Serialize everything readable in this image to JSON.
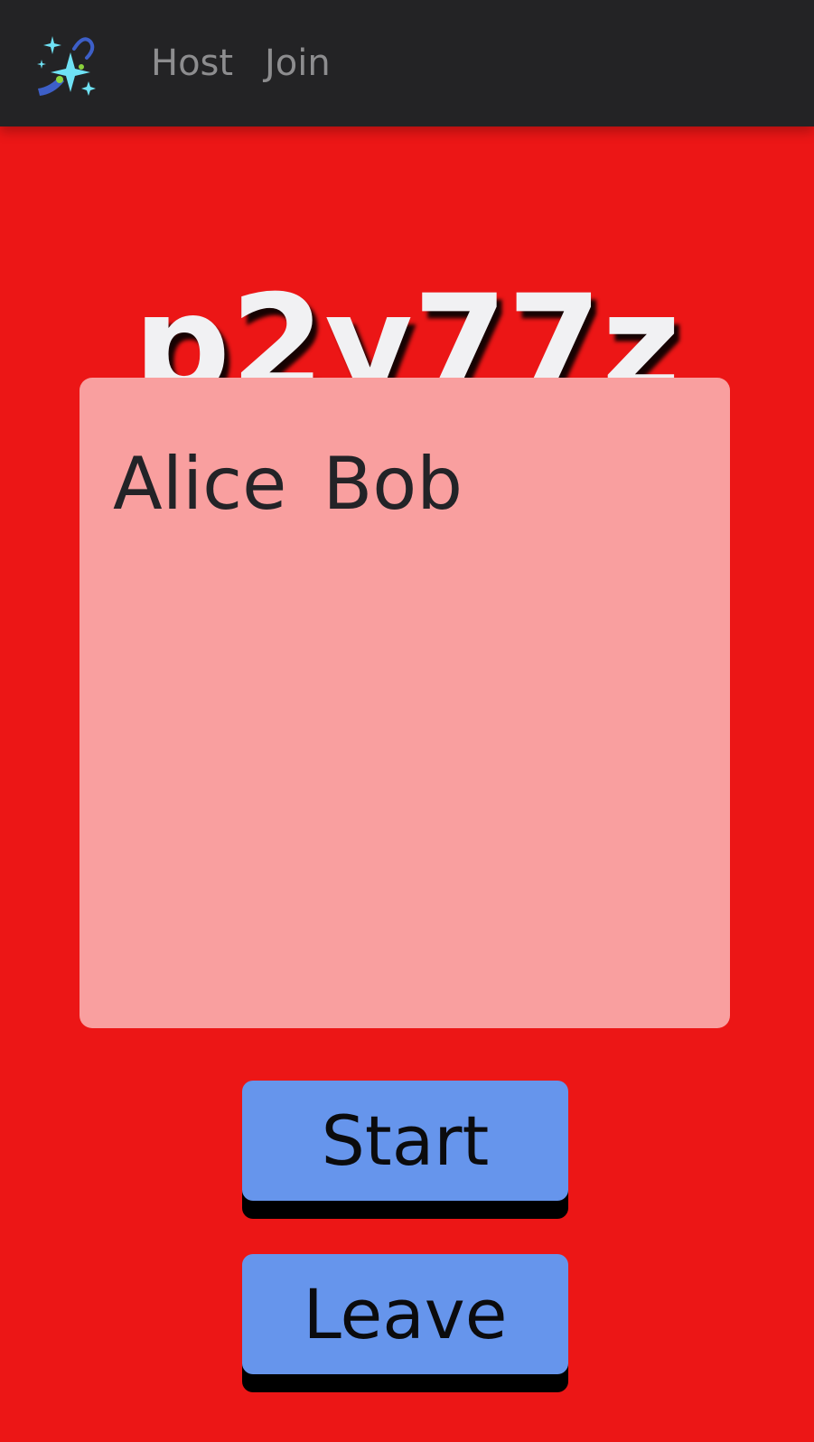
{
  "nav": {
    "logo_icon": "sparkles-icon",
    "links": [
      {
        "label": "Host"
      },
      {
        "label": "Join"
      }
    ]
  },
  "lobby": {
    "code": "p2y77z",
    "players": [
      "Alice",
      "Bob"
    ]
  },
  "actions": {
    "start_label": "Start",
    "leave_label": "Leave"
  },
  "colors": {
    "page_background": "#ec1616",
    "navbar_background": "#232325",
    "panel_background": "#f99f9f",
    "button_background": "#6695ec"
  }
}
